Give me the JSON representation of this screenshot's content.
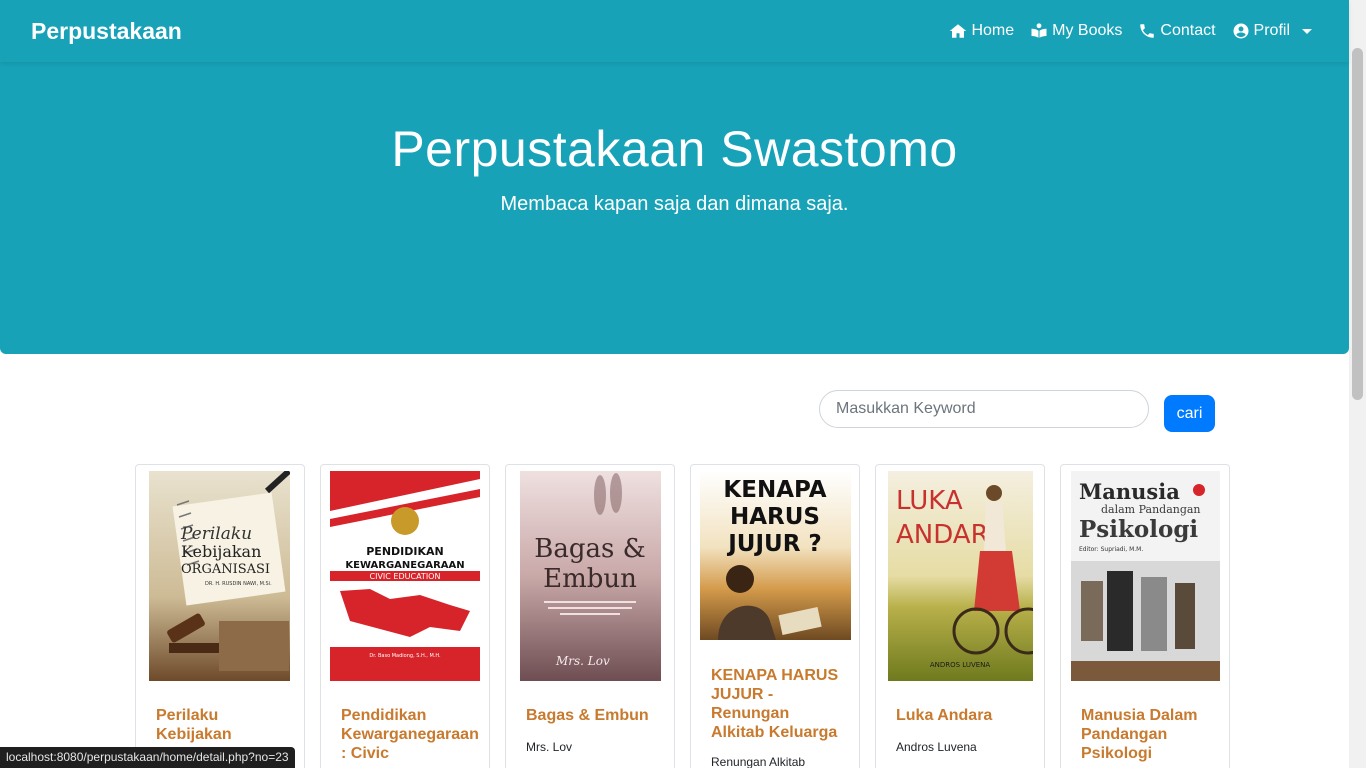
{
  "navbar": {
    "brand": "Perpustakaan",
    "links": [
      {
        "label": "Home",
        "icon": "home-icon"
      },
      {
        "label": "My Books",
        "icon": "book-reader-icon"
      },
      {
        "label": "Contact",
        "icon": "phone-icon"
      },
      {
        "label": "Profil",
        "icon": "user-circle-icon"
      }
    ]
  },
  "hero": {
    "title": "Perpustakaan Swastomo",
    "subtitle": "Membaca kapan saja dan dimana saja."
  },
  "search": {
    "placeholder": "Masukkan Keyword",
    "button_label": "cari"
  },
  "books": [
    {
      "title": "Perilaku Kebijakan",
      "author": "",
      "cover_lines": [
        "Perilaku",
        "Kebijakan",
        "ORGANISASI"
      ],
      "cover_author": "DR. H. RUSDIN NAWI, M.Si."
    },
    {
      "title": "Pendidikan Kewarganegaraan : Civic",
      "author": "",
      "cover_lines": [
        "PENDIDIKAN",
        "KEWARGANEGARAAN",
        "CIVIC EDUCATION"
      ],
      "cover_author": "Dr. Baso Madiong, S.H., M.H."
    },
    {
      "title": "Bagas & Embun",
      "author": "Mrs. Lov",
      "cover_lines": [
        "Bagas &",
        "Embun"
      ],
      "cover_author": "Mrs. Lov"
    },
    {
      "title": "KENAPA HARUS JUJUR - Renungan Alkitab Keluarga",
      "author": "Renungan Alkitab",
      "cover_lines": [
        "KENAPA",
        "HARUS",
        "JUJUR ?"
      ],
      "cover_author": ""
    },
    {
      "title": "Luka Andara",
      "author": "Andros Luvena",
      "cover_lines": [
        "LUKA",
        "ANDARA"
      ],
      "cover_author": "ANDROS LUVENA"
    },
    {
      "title": "Manusia Dalam Pandangan Psikologi",
      "author": "",
      "cover_lines": [
        "Manusia",
        "dalam Pandangan",
        "Psikologi"
      ],
      "cover_author": "Editor: Supriadi, M.M."
    }
  ],
  "status_url": "localhost:8080/perpustakaan/home/detail.php?no=23",
  "colors": {
    "primary": "#17a2b8",
    "accent_button": "#007bff",
    "book_title": "#c87a2e"
  }
}
